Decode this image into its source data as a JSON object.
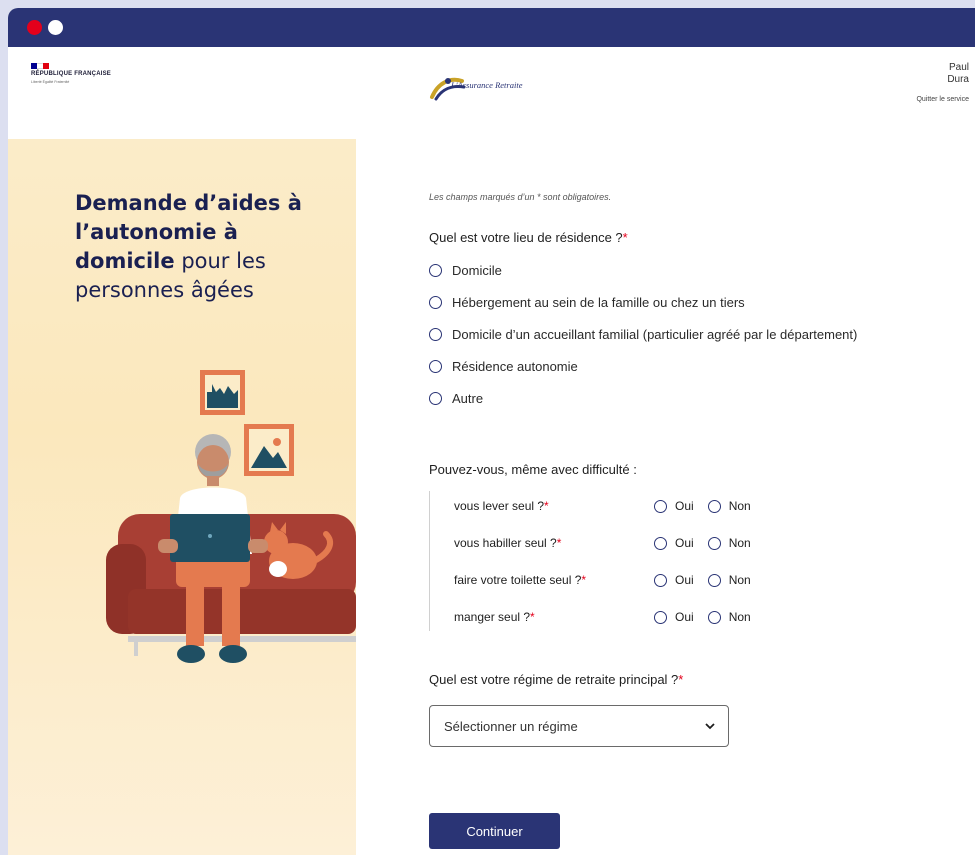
{
  "header": {
    "republique": "RÉPUBLIQUE FRANÇAISE",
    "motto": "Liberté Égalité Fraternité",
    "brand": "L'Assurance Retraite",
    "user_first": "Paul",
    "user_last": "Dura",
    "quit_label": "Quitter le service",
    "flag_colors": [
      "#000091",
      "#ffffff",
      "#e1000f"
    ]
  },
  "hero": {
    "bold1": "Demande d’aides à l’autonomie à domicile",
    "normal1": " pour les personnes âgées"
  },
  "form": {
    "required_note": "Les champs marqués d’un * sont obligatoires.",
    "residence": {
      "question": "Quel est votre lieu de résidence ?",
      "options": [
        "Domicile",
        "Hébergement au sein de la famille ou chez un tiers",
        "Domicile d’un accueillant familial (particulier agréé par le département)",
        "Résidence autonomie",
        "Autre"
      ]
    },
    "difficulty": {
      "question": "Pouvez-vous, même avec difficulté :",
      "yes": "Oui",
      "no": "Non",
      "items": [
        "vous lever seul ?",
        "vous habiller seul ?",
        "faire votre toilette seul ?",
        "manger seul ?"
      ]
    },
    "regime": {
      "question": "Quel est votre régime de retraite principal ?",
      "placeholder": "Sélectionner un régime"
    },
    "submit": "Continuer"
  },
  "colors": {
    "primary": "#2a3475",
    "required": "#e3001b",
    "left_panel": "#fbecc9"
  }
}
